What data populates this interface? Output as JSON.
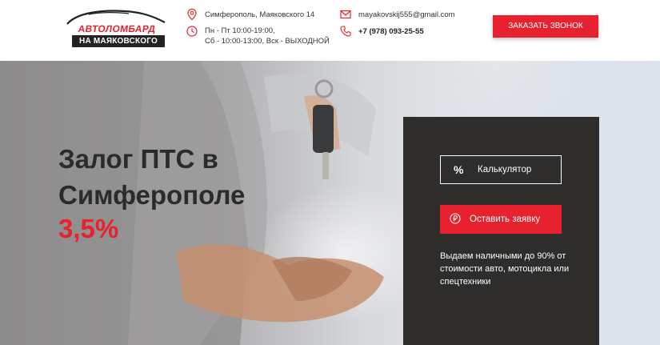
{
  "header": {
    "logo_top": "АВТОЛОМБАРД",
    "logo_bottom": "НА МАЯКОВСКОГО",
    "address": "Симферополь, Маяковского 14",
    "hours_line1": "Пн - Пт 10:00-19:00,",
    "hours_line2": "Сб - 10:00-13:00, Вск - ВЫХОДНОЙ",
    "email": "mayakovskij555@gmail.com",
    "phone": "+7 (978) 093-25-55",
    "callback_label": "ЗАКАЗАТЬ ЗВОНОК"
  },
  "hero": {
    "title_line1": "Залог ПТС в",
    "title_line2": "Симферополе",
    "rate": "3,5%"
  },
  "panel": {
    "calc_icon": "%",
    "calc_label": "Калькулятор",
    "apply_label": "Оставить заявку",
    "note": "Выдаем наличными до 90% от стоимости авто, мотоцикла или спецтехники"
  },
  "colors": {
    "accent": "#e8212e",
    "panel_bg": "#2f2d2b",
    "text_dark": "#2b2b2b"
  }
}
